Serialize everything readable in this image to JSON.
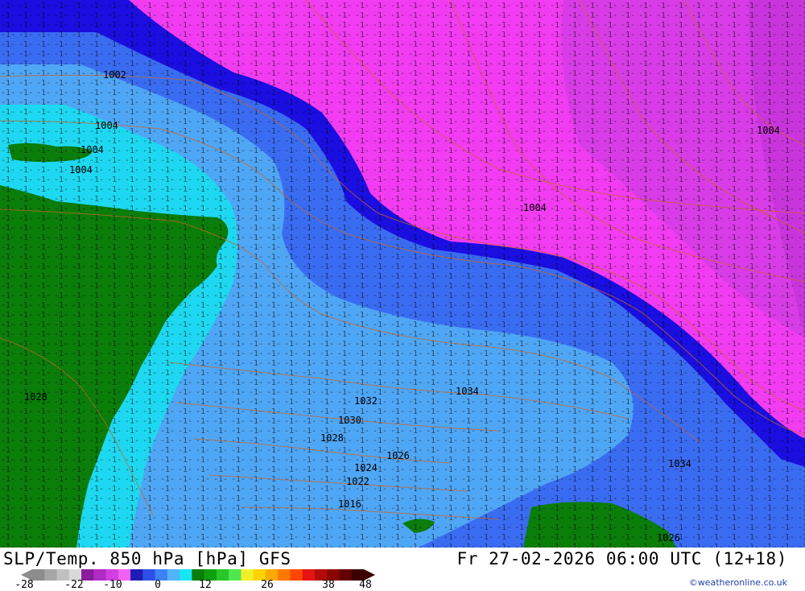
{
  "map": {
    "pressure_labels": [
      "1002",
      "1004",
      "1004",
      "1004",
      "1004",
      "1004",
      "1028",
      "1032",
      "1030",
      "1028",
      "1026",
      "1024",
      "1022",
      "1034",
      "1034",
      "1026",
      "1016"
    ],
    "accent_colors": {
      "magenta": "#f13cf1",
      "violet": "#c23ad6",
      "deep_blue": "#1a0fe0",
      "blue": "#3a6cf2",
      "light_blue": "#4fa6f5",
      "cyan": "#1dd8f0",
      "land_green": "#0a7d0a",
      "isobar": "#c8642a"
    }
  },
  "footer": {
    "title": "SLP/Temp. 850 hPa [hPa] GFS",
    "datetime": "Fr 27-02-2026 06:00 UTC (12+18)",
    "credit": "©weatheronline.co.uk",
    "legend_ticks": [
      "-28",
      "-22",
      "-10",
      "0",
      "12",
      "26",
      "38",
      "48"
    ],
    "legend_colors": [
      "#8c8c8c",
      "#a6a6a6",
      "#c0c0c0",
      "#d9d9d9",
      "#8a1c9e",
      "#b02ac4",
      "#d23ee0",
      "#f060f2",
      "#1e1eb4",
      "#2d50e6",
      "#3c82f5",
      "#50b4fa",
      "#18e6f5",
      "#0a7d0a",
      "#0fa00f",
      "#28c828",
      "#50e650",
      "#f0f028",
      "#ffd200",
      "#ffaa00",
      "#ff7800",
      "#ff4600",
      "#e61414",
      "#b40a0a",
      "#8c0505",
      "#640000",
      "#3c0000"
    ]
  }
}
